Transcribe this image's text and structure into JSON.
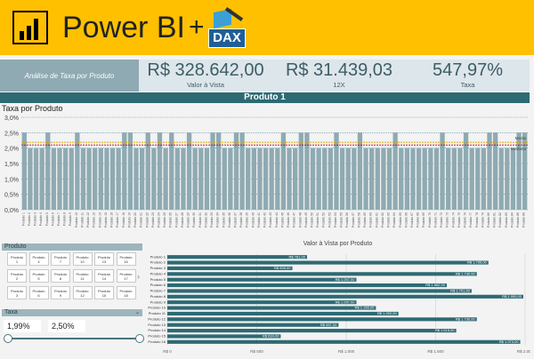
{
  "header": {
    "brand": "Power BI",
    "plus": "+",
    "dax_label": "DAX"
  },
  "kpi": {
    "panel_title": "Análise de Taxa por Produto",
    "items": [
      {
        "value": "R$ 328.642,00",
        "label": "Valor à Vista"
      },
      {
        "value": "R$ 31.439,03",
        "label": "12X"
      },
      {
        "value": "547,97%",
        "label": "Taxa"
      }
    ]
  },
  "product_title": "Produto 1",
  "filters": {
    "produto_label": "Produto",
    "tiles": [
      [
        "Produto\n1",
        "Produto\n4",
        "Produto\n7",
        "Produto\n10",
        "Produto\n13",
        "Produto\n16"
      ],
      [
        "Produto\n2",
        "Produto\n5",
        "Produto\n8",
        "Produto\n11",
        "Produto\n14",
        "Produto\n17"
      ],
      [
        "Produto\n3",
        "Produto\n6",
        "Produto\n9",
        "Produto\n12",
        "Produto\n15",
        "Produto\n18"
      ]
    ],
    "taxa_label": "Taxa",
    "taxa_min": "1,99%",
    "taxa_max": "2,50%",
    "taxa_min_fraction": 0.0,
    "taxa_max_fraction": 1.0
  },
  "colors": {
    "bar": "#8faab2",
    "accent_dark": "#2e6a73",
    "banner": "#ffc000",
    "media_line": "#d9a400",
    "mediana_line": "#c00000"
  },
  "chart_data": [
    {
      "type": "bar",
      "title": "Taxa por Produto",
      "y_tick_labels": [
        "0,0%",
        "0,5%",
        "1,0%",
        "1,5%",
        "2,0%",
        "2,5%",
        "3,0%"
      ],
      "ylim": [
        0,
        3
      ],
      "annotations": [
        {
          "label": "Media",
          "value": 2.19
        },
        {
          "label": "Mediana",
          "value": 2.1
        }
      ],
      "categories": [
        "Produto 1",
        "Produto 2",
        "Produto 3",
        "Produto 4",
        "Produto 5",
        "Produto 6",
        "Produto 7",
        "Produto 8",
        "Produto 9",
        "Produto 10",
        "Produto 11",
        "Produto 12",
        "Produto 13",
        "Produto 14",
        "Produto 15",
        "Produto 16",
        "Produto 17",
        "Produto 18",
        "Produto 19",
        "Produto 20",
        "Produto 21",
        "Produto 22",
        "Produto 23",
        "Produto 24",
        "Produto 25",
        "Produto 26",
        "Produto 27",
        "Produto 28",
        "Produto 29",
        "Produto 30",
        "Produto 31",
        "Produto 32",
        "Produto 33",
        "Produto 34",
        "Produto 35",
        "Produto 36",
        "Produto 37",
        "Produto 38",
        "Produto 39",
        "Produto 40",
        "Produto 41",
        "Produto 42",
        "Produto 43",
        "Produto 44",
        "Produto 45",
        "Produto 46",
        "Produto 47",
        "Produto 48",
        "Produto 49",
        "Produto 50",
        "Produto 51",
        "Produto 52",
        "Produto 53",
        "Produto 54",
        "Produto 55",
        "Produto 56",
        "Produto 57",
        "Produto 58",
        "Produto 59",
        "Produto 60",
        "Produto 61",
        "Produto 62",
        "Produto 63",
        "Produto 64",
        "Produto 65",
        "Produto 66",
        "Produto 67",
        "Produto 68",
        "Produto 69",
        "Produto 70",
        "Produto 71",
        "Produto 72",
        "Produto 73",
        "Produto 74",
        "Produto 75",
        "Produto 76",
        "Produto 77",
        "Produto 78",
        "Produto 79",
        "Produto 80",
        "Produto 81",
        "Produto 82",
        "Produto 83",
        "Produto 84",
        "Produto 85",
        "Produto 86"
      ],
      "values": [
        2.5,
        2.0,
        2.0,
        2.0,
        2.5,
        2.0,
        2.0,
        2.0,
        2.0,
        2.5,
        2.0,
        2.0,
        2.0,
        2.0,
        2.0,
        2.0,
        2.0,
        2.5,
        2.5,
        2.0,
        2.0,
        2.5,
        2.0,
        2.5,
        2.0,
        2.5,
        2.0,
        2.0,
        2.5,
        2.0,
        2.0,
        2.0,
        2.5,
        2.5,
        2.0,
        2.0,
        2.5,
        2.5,
        2.0,
        2.0,
        2.0,
        2.0,
        2.0,
        2.0,
        2.5,
        2.0,
        2.0,
        2.5,
        2.5,
        2.0,
        2.0,
        2.0,
        2.0,
        2.5,
        2.0,
        2.0,
        2.0,
        2.5,
        2.0,
        2.0,
        2.0,
        2.0,
        2.0,
        2.5,
        2.0,
        2.0,
        2.0,
        2.0,
        2.0,
        2.0,
        2.0,
        2.5,
        2.0,
        2.0,
        2.0,
        2.5,
        2.0,
        2.0,
        2.0,
        2.5,
        2.5,
        2.0,
        2.0,
        2.0,
        2.5,
        2.5
      ]
    },
    {
      "type": "bar",
      "orientation": "horizontal",
      "title": "Valor à Vista por Produto",
      "x_tick_labels": [
        "R$ 0",
        "R$ 500",
        "R$ 1.000",
        "R$ 1.500",
        "R$ 2.000"
      ],
      "xlim": [
        0,
        2000
      ],
      "categories": [
        "Produto 1",
        "Produto 2",
        "Produto 3",
        "Produto 4",
        "Produto 5",
        "Produto 6",
        "Produto 7",
        "Produto 8",
        "Produto 9",
        "Produto 10",
        "Produto 11",
        "Produto 12",
        "Produto 13",
        "Produto 14",
        "Produto 15",
        "Produto 16"
      ],
      "values": [
        781,
        1795,
        699,
        1730,
        1057,
        1562,
        1701,
        1990,
        1057,
        1166,
        1292,
        1730,
        957,
        1615,
        634,
        1973
      ],
      "data_labels": [
        "R$ 781,00",
        "R$ 1.795,00",
        "R$ 699,00",
        "R$ 1.730,00",
        "R$ 1.057,00",
        "R$ 1.562,00",
        "R$ 1.701,00",
        "R$ 1.990,00",
        "R$ 1.057,00",
        "R$ 1.166,00",
        "R$ 1.292,00",
        "R$ 1.730,00",
        "R$ 957,00",
        "R$ 1.615,00",
        "R$ 634,00",
        "R$ 1.973,00"
      ]
    }
  ]
}
